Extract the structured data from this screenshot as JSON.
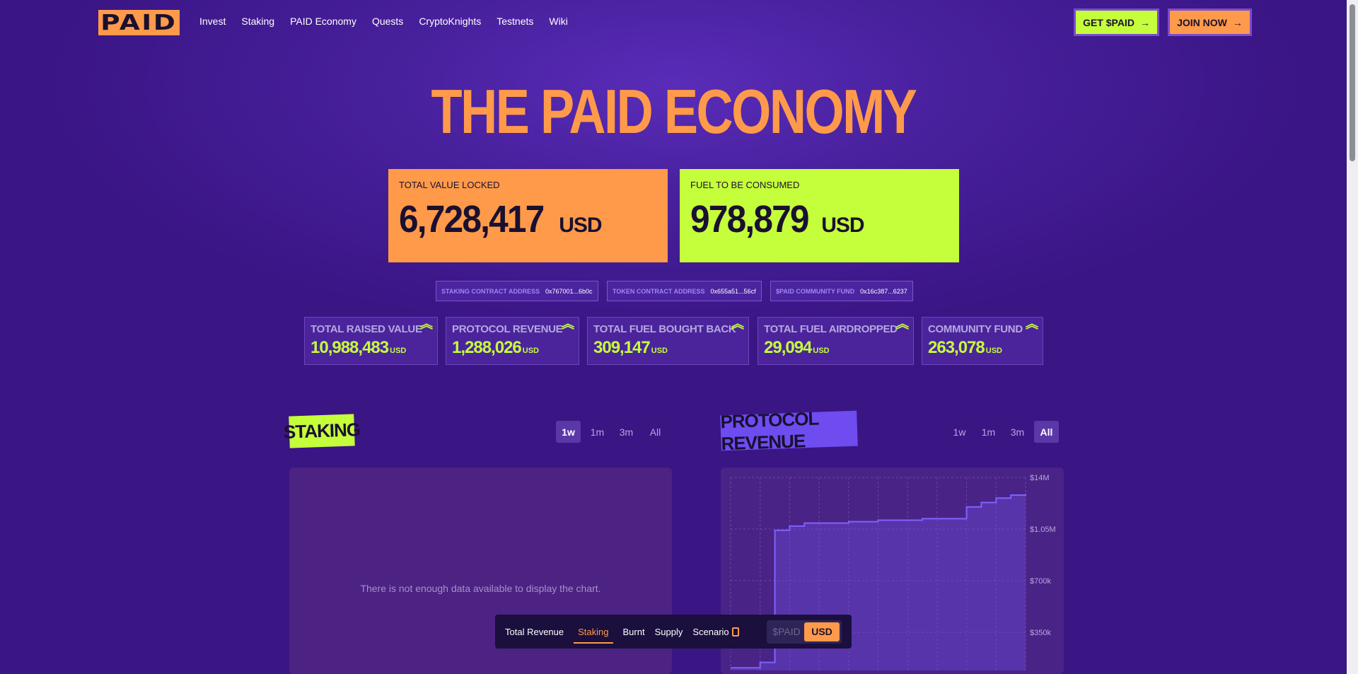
{
  "header": {
    "logo": "PAID",
    "nav": [
      "Invest",
      "Staking",
      "PAID Economy",
      "Quests",
      "CryptoKnights",
      "Testnets",
      "Wiki"
    ],
    "get_label": "GET $PAID",
    "join_label": "JOIN NOW"
  },
  "hero": {
    "title": "THE PAID ECONOMY"
  },
  "big_stats": {
    "tvl": {
      "label": "TOTAL VALUE LOCKED",
      "value": "6,728,417",
      "unit": "USD"
    },
    "fuel": {
      "label": "FUEL TO BE CONSUMED",
      "value": "978,879",
      "unit": "USD"
    }
  },
  "addresses": [
    {
      "key": "STAKING CONTRACT ADDRESS",
      "value": "0x767001...6b0c"
    },
    {
      "key": "TOKEN CONTRACT ADDRESS",
      "value": "0x655a51...56cf"
    },
    {
      "key": "$PAID COMMUNITY FUND",
      "value": "0x16c387...6237"
    }
  ],
  "stats": [
    {
      "label": "TOTAL RAISED VALUE",
      "value": "10,988,483",
      "unit": "USD"
    },
    {
      "label": "PROTOCOL REVENUE",
      "value": "1,288,026",
      "unit": "USD"
    },
    {
      "label": "TOTAL FUEL BOUGHT BACK",
      "value": "309,147",
      "unit": "USD"
    },
    {
      "label": "TOTAL FUEL AIRDROPPED",
      "value": "29,094",
      "unit": "USD"
    },
    {
      "label": "COMMUNITY FUND",
      "value": "263,078",
      "unit": "USD"
    }
  ],
  "staking": {
    "title": "STAKING",
    "ranges": [
      "1w",
      "1m",
      "3m",
      "All"
    ],
    "active_range": "1w",
    "empty_message": "There is not enough data available to display the chart."
  },
  "revenue": {
    "title": "PROTOCOL REVENUE",
    "ranges": [
      "1w",
      "1m",
      "3m",
      "All"
    ],
    "active_range": "All"
  },
  "chart_data": {
    "type": "area",
    "title": "PROTOCOL REVENUE",
    "y_ticks": [
      "$14M",
      "$1.05M",
      "$700k",
      "$350k"
    ],
    "ylim": [
      0,
      1400000
    ],
    "x": [
      0,
      1,
      2,
      3,
      4,
      5,
      6,
      7,
      8,
      9,
      10,
      11,
      12,
      13,
      14,
      15,
      16,
      17,
      18,
      19,
      20
    ],
    "values": [
      20000,
      20000,
      60000,
      1040000,
      1070000,
      1090000,
      1090000,
      1090000,
      1100000,
      1100000,
      1110000,
      1110000,
      1110000,
      1120000,
      1120000,
      1120000,
      1200000,
      1230000,
      1260000,
      1280000,
      1288026
    ],
    "grid": true
  },
  "tabbar": {
    "tabs": [
      "Total Revenue",
      "Staking",
      "Burnt",
      "Supply",
      "Scenario"
    ],
    "active_tab": "Staking",
    "currency_options": [
      "$PAID",
      "USD"
    ],
    "active_currency": "USD"
  },
  "colors": {
    "orange": "#ff9a4a",
    "lime": "#c5ff3b",
    "purple": "#6e4cf0",
    "bg": "#3a1584"
  }
}
